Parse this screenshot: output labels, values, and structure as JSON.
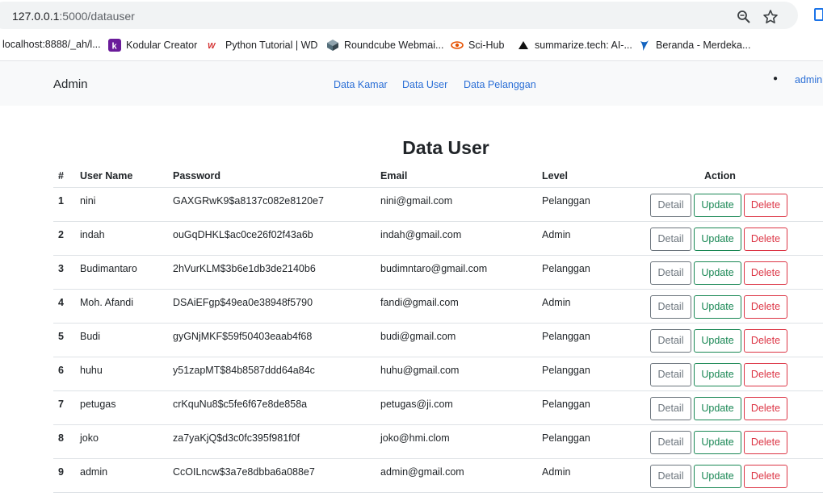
{
  "browser": {
    "url_host": "127.0.0.1",
    "url_path": ":5000/datauser",
    "bookmarks": [
      {
        "label": "localhost:8888/_ah/l...",
        "icon": "none"
      },
      {
        "label": "Kodular Creator",
        "icon": "kodular-icon"
      },
      {
        "label": "Python Tutorial | WD",
        "icon": "wd-icon"
      },
      {
        "label": "Roundcube Webmai...",
        "icon": "roundcube-icon"
      },
      {
        "label": "Sci-Hub",
        "icon": "scihub-icon"
      },
      {
        "label": "summarize.tech: AI-...",
        "icon": "triangle-icon"
      },
      {
        "label": "Beranda - Merdeka...",
        "icon": "merdeka-icon"
      }
    ]
  },
  "navbar": {
    "brand": "Admin",
    "links": [
      "Data Kamar",
      "Data User",
      "Data Pelanggan"
    ],
    "user": "admin"
  },
  "page": {
    "title": "Data User"
  },
  "table": {
    "headers": [
      "#",
      "User Name",
      "Password",
      "Email",
      "Level",
      "Action"
    ],
    "rows": [
      {
        "no": "1",
        "username": "nini",
        "password": "GAXGRwK9$a8137c082e8120e7",
        "email": "nini@gmail.com",
        "level": "Pelanggan"
      },
      {
        "no": "2",
        "username": "indah",
        "password": "ouGqDHKL$ac0ce26f02f43a6b",
        "email": "indah@gmail.com",
        "level": "Admin"
      },
      {
        "no": "3",
        "username": "Budimantaro",
        "password": "2hVurKLM$3b6e1db3de2140b6",
        "email": "budimntaro@gmail.com",
        "level": "Pelanggan"
      },
      {
        "no": "4",
        "username": "Moh. Afandi",
        "password": "DSAiEFgp$49ea0e38948f5790",
        "email": "fandi@gmail.com",
        "level": "Admin"
      },
      {
        "no": "5",
        "username": "Budi",
        "password": "gyGNjMKF$59f50403eaab4f68",
        "email": "budi@gmail.com",
        "level": "Pelanggan"
      },
      {
        "no": "6",
        "username": "huhu",
        "password": "y51zapMT$84b8587ddd64a84c",
        "email": "huhu@gmail.com",
        "level": "Pelanggan"
      },
      {
        "no": "7",
        "username": "petugas",
        "password": "crKquNu8$c5fe6f67e8de858a",
        "email": "petugas@ji.com",
        "level": "Pelanggan"
      },
      {
        "no": "8",
        "username": "joko",
        "password": "za7yaKjQ$d3c0fc395f981f0f",
        "email": "joko@hmi.clom",
        "level": "Pelanggan"
      },
      {
        "no": "9",
        "username": "admin",
        "password": "CcOILncw$3a7e8dbba6a088e7",
        "email": "admin@gmail.com",
        "level": "Admin"
      }
    ],
    "actions": {
      "detail": "Detail",
      "update": "Update",
      "delete": "Delete"
    }
  },
  "colors": {
    "link": "#2b6fd6",
    "detail": "#6c757d",
    "update": "#198754",
    "delete": "#dc3545"
  }
}
